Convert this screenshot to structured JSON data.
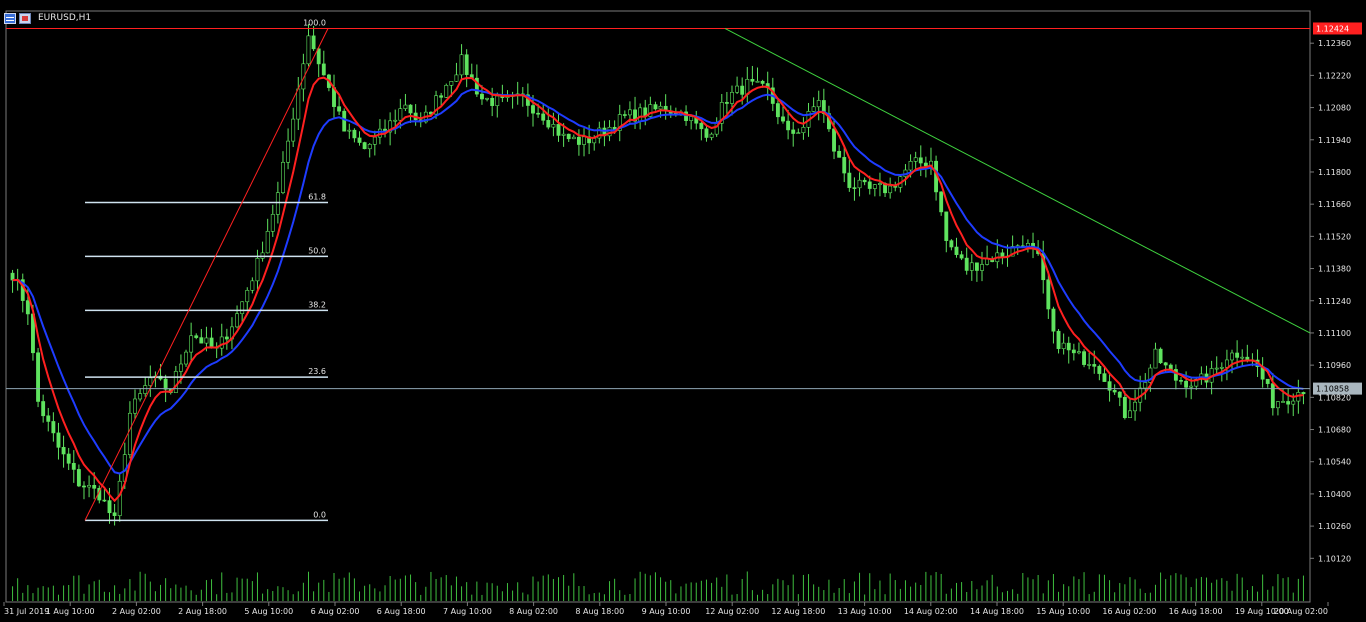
{
  "window": {
    "title": "EURUSD,H1",
    "icons": [
      "list-icon",
      "chart-window-icon"
    ]
  },
  "colors": {
    "background": "#000000",
    "candle": "#5fe35f",
    "ma_fast": "#ff2020",
    "ma_slow": "#1e3cff",
    "fibo": "#cfe3f0",
    "trendline": "#3fd23f",
    "high_line": "#ff2020",
    "ask_line": "#8fa6b4",
    "volume": "#3fbf3f",
    "axis_text": "#e6e6e6"
  },
  "chart_data": {
    "type": "candlestick",
    "symbol": "EURUSD",
    "timeframe": "H1",
    "ylim": [
      1.0993,
      1.125
    ],
    "y_ticks": [
      "1.12360",
      "1.12220",
      "1.12080",
      "1.11940",
      "1.11800",
      "1.11660",
      "1.11520",
      "1.11380",
      "1.11240",
      "1.11100",
      "1.10960",
      "1.10820",
      "1.10680",
      "1.10540",
      "1.10400",
      "1.10260",
      "1.10120"
    ],
    "x_ticks": [
      "31 Jul 2019",
      "1 Aug 10:00",
      "2 Aug 02:00",
      "2 Aug 18:00",
      "5 Aug 10:00",
      "6 Aug 02:00",
      "6 Aug 18:00",
      "7 Aug 10:00",
      "8 Aug 02:00",
      "8 Aug 18:00",
      "9 Aug 10:00",
      "12 Aug 02:00",
      "12 Aug 18:00",
      "13 Aug 10:00",
      "14 Aug 02:00",
      "14 Aug 18:00",
      "15 Aug 10:00",
      "16 Aug 02:00",
      "16 Aug 18:00",
      "19 Aug 10:00",
      "20 Aug 02:00"
    ],
    "price_path": [
      [
        0,
        1.1136
      ],
      [
        3,
        1.112
      ],
      [
        5,
        1.108
      ],
      [
        9,
        1.106
      ],
      [
        13,
        1.1045
      ],
      [
        17,
        1.104
      ],
      [
        20,
        1.1028
      ],
      [
        23,
        1.1075
      ],
      [
        27,
        1.109
      ],
      [
        31,
        1.1085
      ],
      [
        35,
        1.111
      ],
      [
        40,
        1.1102
      ],
      [
        44,
        1.1118
      ],
      [
        48,
        1.114
      ],
      [
        52,
        1.117
      ],
      [
        55,
        1.1205
      ],
      [
        58,
        1.124
      ],
      [
        61,
        1.1222
      ],
      [
        65,
        1.1198
      ],
      [
        69,
        1.119
      ],
      [
        73,
        1.1198
      ],
      [
        77,
        1.121
      ],
      [
        80,
        1.12
      ],
      [
        84,
        1.1215
      ],
      [
        88,
        1.1228
      ],
      [
        92,
        1.1212
      ],
      [
        96,
        1.121
      ],
      [
        100,
        1.1212
      ],
      [
        104,
        1.1205
      ],
      [
        108,
        1.1195
      ],
      [
        112,
        1.1193
      ],
      [
        116,
        1.1198
      ],
      [
        120,
        1.1204
      ],
      [
        124,
        1.1206
      ],
      [
        128,
        1.1208
      ],
      [
        132,
        1.1205
      ],
      [
        136,
        1.1195
      ],
      [
        140,
        1.1212
      ],
      [
        144,
        1.1218
      ],
      [
        148,
        1.1215
      ],
      [
        152,
        1.1196
      ],
      [
        155,
        1.12
      ],
      [
        158,
        1.1212
      ],
      [
        161,
        1.119
      ],
      [
        164,
        1.1175
      ],
      [
        168,
        1.1172
      ],
      [
        172,
        1.1173
      ],
      [
        176,
        1.1183
      ],
      [
        180,
        1.1185
      ],
      [
        183,
        1.115
      ],
      [
        187,
        1.1138
      ],
      [
        191,
        1.1142
      ],
      [
        195,
        1.1145
      ],
      [
        198,
        1.115
      ],
      [
        201,
        1.1142
      ],
      [
        204,
        1.1108
      ],
      [
        208,
        1.11
      ],
      [
        212,
        1.1098
      ],
      [
        215,
        1.1088
      ],
      [
        218,
        1.1075
      ],
      [
        221,
        1.1085
      ],
      [
        224,
        1.11
      ],
      [
        228,
        1.109
      ],
      [
        232,
        1.1088
      ],
      [
        235,
        1.1092
      ],
      [
        238,
        1.11
      ],
      [
        241,
        1.1102
      ],
      [
        244,
        1.1095
      ],
      [
        247,
        1.108
      ],
      [
        250,
        1.1082
      ],
      [
        253,
        1.1086
      ]
    ],
    "fibo_levels": [
      {
        "label": "100.0",
        "price": 1.12424
      },
      {
        "label": "61.8",
        "price": 1.11667
      },
      {
        "label": "50.0",
        "price": 1.11433
      },
      {
        "label": "38.2",
        "price": 1.11198
      },
      {
        "label": "23.6",
        "price": 1.10908
      },
      {
        "label": "0.0",
        "price": 1.10285
      }
    ],
    "high_price": 1.12424,
    "current_price": 1.10858,
    "high_label": "1.12424",
    "current_label": "1.10858"
  }
}
